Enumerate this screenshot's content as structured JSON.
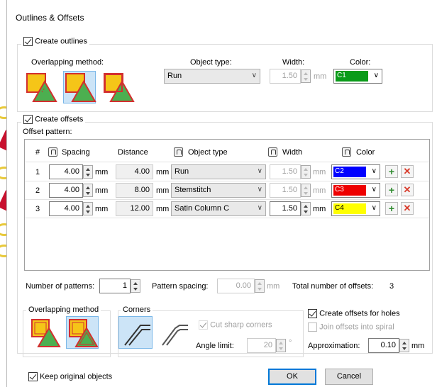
{
  "dialog": {
    "title": "Outlines & Offsets"
  },
  "outlines": {
    "create_label": "Create outlines",
    "overlap_label": "Overlapping method:",
    "object_type_label": "Object type:",
    "object_type_value": "Run",
    "width_label": "Width:",
    "width_value": "1.50",
    "width_unit": "mm",
    "color_label": "Color:",
    "color_value": "C1",
    "color_hex": "#0a9b19"
  },
  "offsets": {
    "create_label": "Create offsets",
    "pattern_label": "Offset pattern:",
    "headers": {
      "num": "#",
      "spacing": "Spacing",
      "distance": "Distance",
      "object_type": "Object type",
      "width": "Width",
      "color": "Color"
    },
    "rows": [
      {
        "num": "1",
        "spacing": "4.00",
        "spacing_unit": "mm",
        "distance": "4.00",
        "distance_unit": "mm",
        "object_type": "Run",
        "width": "1.50",
        "width_unit": "mm",
        "color": "C2",
        "color_hex": "#0000ff",
        "color_text": "#ffffff",
        "enabled": false
      },
      {
        "num": "2",
        "spacing": "4.00",
        "spacing_unit": "mm",
        "distance": "8.00",
        "distance_unit": "mm",
        "object_type": "Stemstitch",
        "width": "1.50",
        "width_unit": "mm",
        "color": "C3",
        "color_hex": "#ee0000",
        "color_text": "#ffffff",
        "enabled": false
      },
      {
        "num": "3",
        "spacing": "4.00",
        "spacing_unit": "mm",
        "distance": "12.00",
        "distance_unit": "mm",
        "object_type": "Satin Column C",
        "width": "1.50",
        "width_unit": "mm",
        "color": "C4",
        "color_hex": "#ffff00",
        "color_text": "#000000",
        "enabled": true
      }
    ],
    "num_patterns_label": "Number of patterns:",
    "num_patterns_value": "1",
    "pattern_spacing_label": "Pattern spacing:",
    "pattern_spacing_value": "0.00",
    "pattern_spacing_unit": "mm",
    "total_label": "Total number of offsets:",
    "total_value": "3"
  },
  "bottom": {
    "overlap_label": "Overlapping method",
    "corners_label": "Corners",
    "cut_sharp_label": "Cut sharp corners",
    "angle_label": "Angle limit:",
    "angle_value": "20",
    "angle_unit": "°",
    "holes_label": "Create offsets for holes",
    "spiral_label": "Join offsets into spiral",
    "approx_label": "Approximation:",
    "approx_value": "0.10",
    "approx_unit": "mm"
  },
  "footer": {
    "keep_label": "Keep original objects",
    "ok": "OK",
    "cancel": "Cancel"
  }
}
